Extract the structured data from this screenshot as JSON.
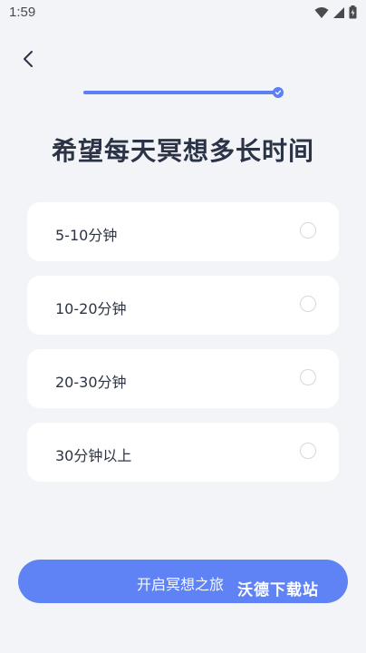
{
  "status_bar": {
    "time": "1:59"
  },
  "progress": {
    "value": 1.0
  },
  "title": "希望每天冥想多长时间",
  "options": [
    {
      "label": "5-10分钟",
      "selected": false
    },
    {
      "label": "10-20分钟",
      "selected": false
    },
    {
      "label": "20-30分钟",
      "selected": false
    },
    {
      "label": "30分钟以上",
      "selected": false
    }
  ],
  "start_button": {
    "label": "开启冥想之旅"
  },
  "watermark": "沃德下载站",
  "colors": {
    "accent": "#5f82f4",
    "background": "#f3f4f8",
    "card": "#ffffff"
  }
}
